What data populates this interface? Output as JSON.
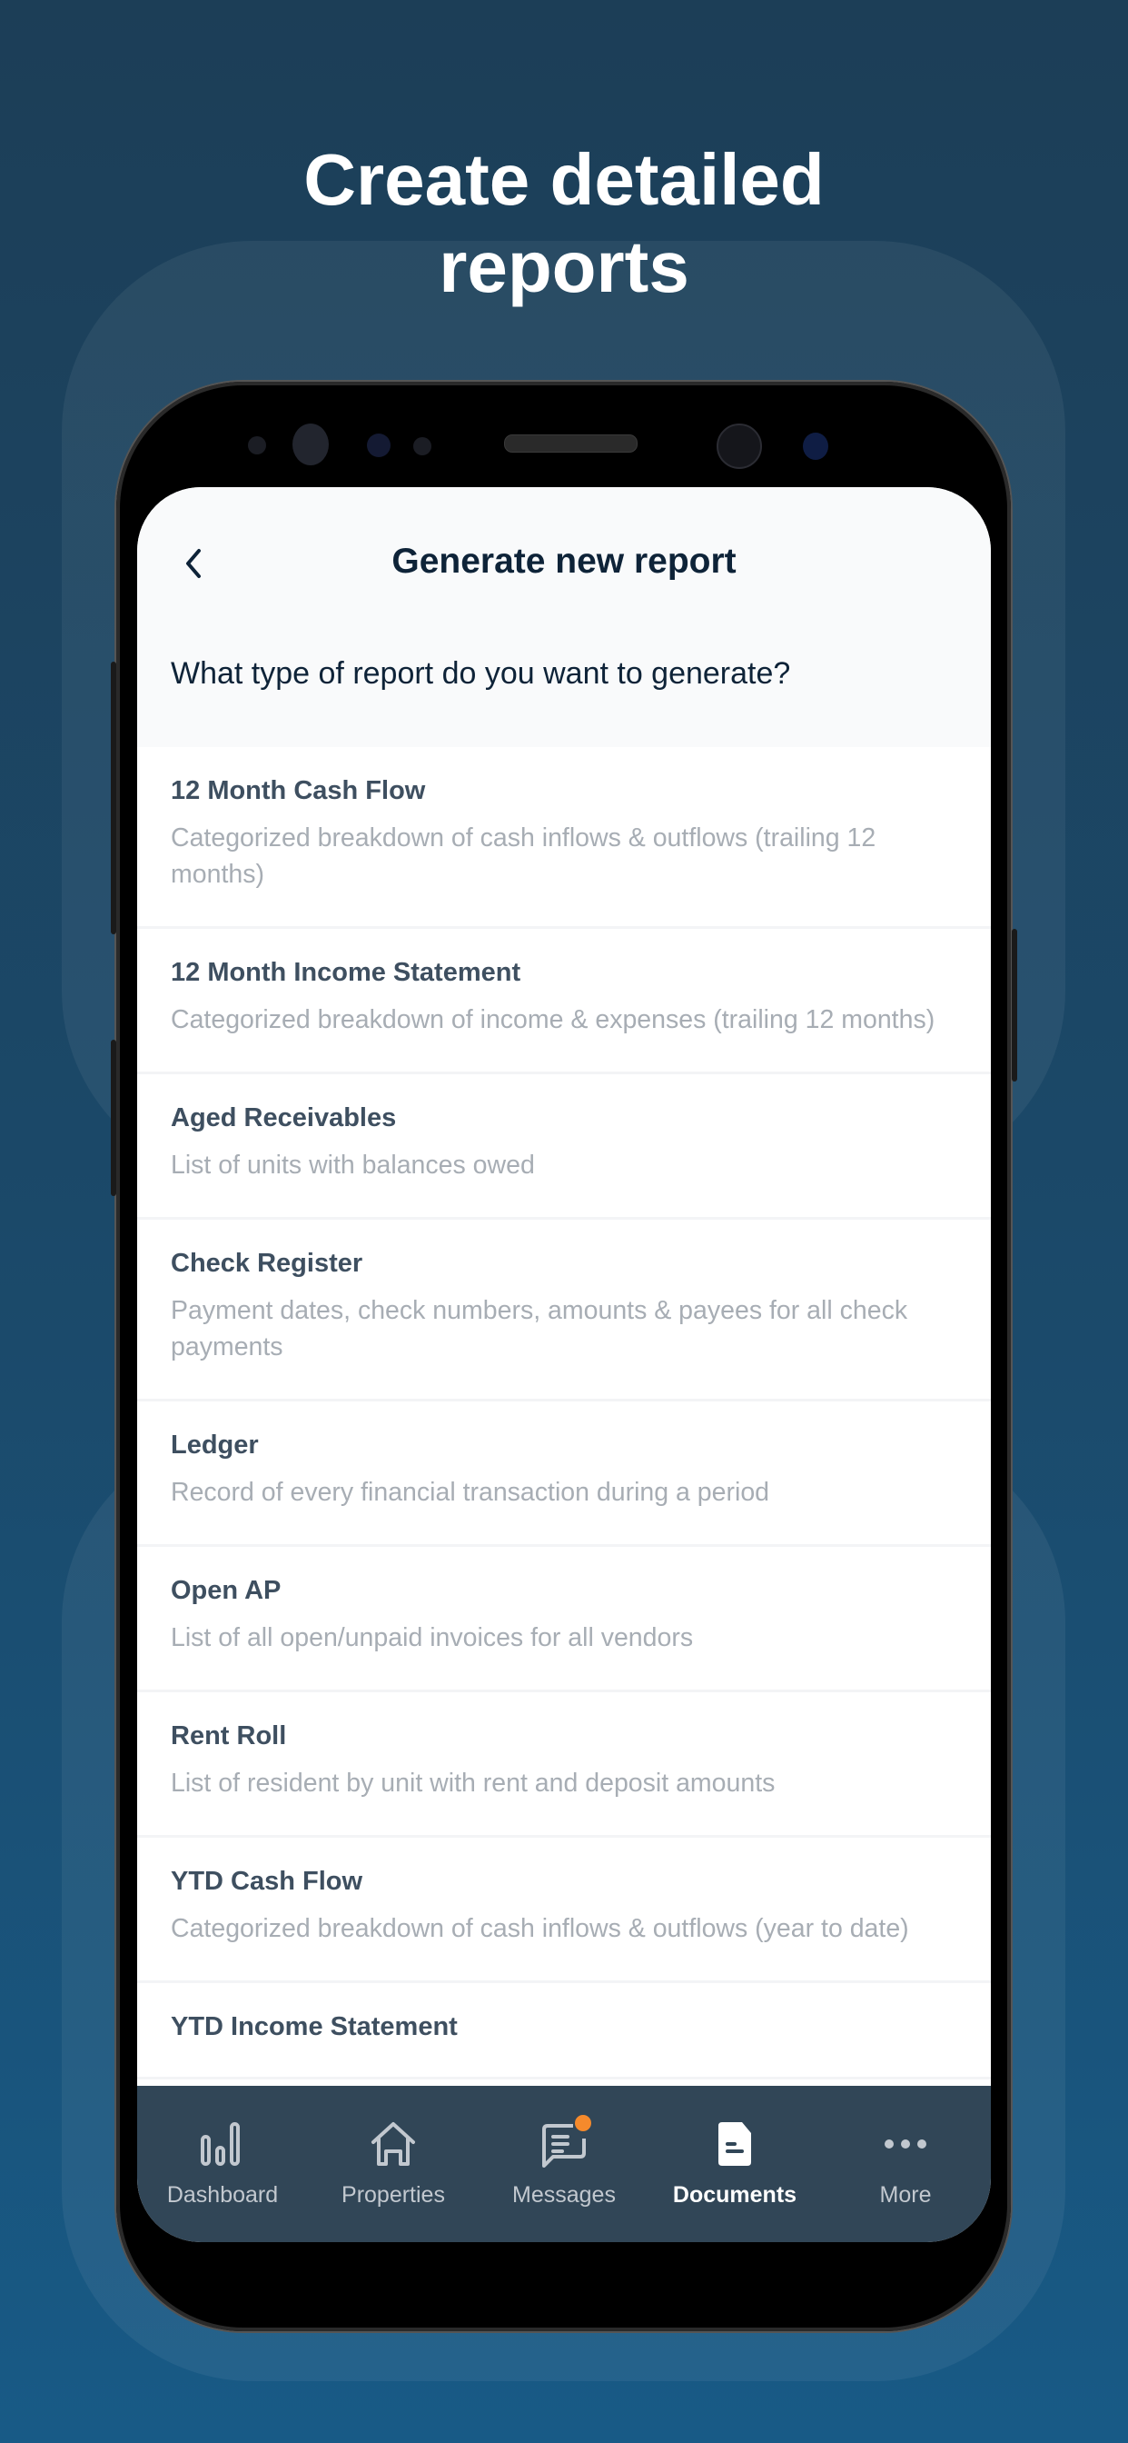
{
  "headline": "Create detailed reports",
  "header": {
    "title": "Generate new report",
    "question": "What type of report do you want to generate?"
  },
  "reports": [
    {
      "title": "12 Month Cash Flow",
      "desc": "Categorized breakdown of cash inflows & outflows (trailing 12 months)"
    },
    {
      "title": "12 Month Income Statement",
      "desc": "Categorized breakdown of income & expenses (trailing 12 months)"
    },
    {
      "title": "Aged Receivables",
      "desc": "List of units with balances owed"
    },
    {
      "title": "Check Register",
      "desc": "Payment dates, check numbers, amounts & payees for all check payments"
    },
    {
      "title": "Ledger",
      "desc": "Record of every financial transaction during a period"
    },
    {
      "title": "Open AP",
      "desc": "List of all open/unpaid invoices for all vendors"
    },
    {
      "title": "Rent Roll",
      "desc": "List of resident by unit with rent and deposit amounts"
    },
    {
      "title": "YTD Cash Flow",
      "desc": "Categorized breakdown of cash inflows & outflows (year to date)"
    },
    {
      "title": "YTD Income Statement",
      "desc": ""
    }
  ],
  "nav": [
    {
      "label": "Dashboard",
      "icon": "chart-icon"
    },
    {
      "label": "Properties",
      "icon": "home-icon"
    },
    {
      "label": "Messages",
      "icon": "message-icon",
      "badge": true
    },
    {
      "label": "Documents",
      "icon": "document-icon",
      "active": true
    },
    {
      "label": "More",
      "icon": "more-icon"
    }
  ],
  "colors": {
    "nav_bg": "#314657",
    "badge": "#f58a2c",
    "title": "#0e2338"
  }
}
